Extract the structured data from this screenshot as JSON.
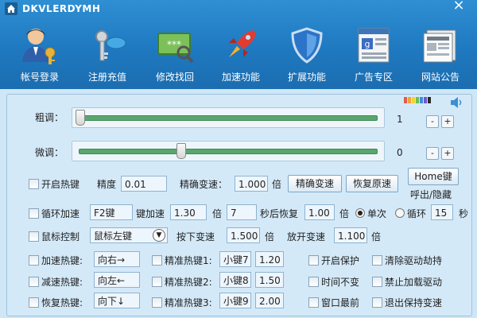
{
  "app": {
    "title": "DKVLERDYMH",
    "close_symbol": "×"
  },
  "nav": [
    {
      "label": "帐号登录",
      "icon": "user-key-icon"
    },
    {
      "label": "注册充值",
      "icon": "keys-icon"
    },
    {
      "label": "修改找回",
      "icon": "password-magnifier-icon"
    },
    {
      "label": "加速功能",
      "icon": "rocket-icon"
    },
    {
      "label": "扩展功能",
      "icon": "shield-icon"
    },
    {
      "label": "广告专区",
      "icon": "ad-page-icon"
    },
    {
      "label": "网站公告",
      "icon": "news-icon"
    }
  ],
  "coarse": {
    "label": "粗调：",
    "value": "1",
    "minus": "-",
    "plus": "+",
    "level": 0.0
  },
  "fine": {
    "label": "微调：",
    "value": "0",
    "minus": "-",
    "plus": "+",
    "level": 0.34
  },
  "row1": {
    "hotkey_label": "开启热键",
    "precision_label": "精度",
    "precision_value": "0.01",
    "exact_speed_label": "精确变速：",
    "exact_speed_value": "1.000",
    "times": "倍",
    "exact_speed_button": "精确变速",
    "restore_button": "恢复原速",
    "home_button": "Home键",
    "home_caption": "呼出/隐藏"
  },
  "row2": {
    "loop_label": "循环加速",
    "loop_key": "F2键",
    "key_speed_label": "键加速",
    "key_speed_value": "1.30",
    "times": "倍",
    "seconds_value": "7",
    "seconds_restore_label": "秒后恢复",
    "restore_value": "1.00",
    "times2": "倍",
    "single_label": "单次",
    "loop_radio_label": "循环",
    "loop_seconds": "15",
    "sec_unit": "秒"
  },
  "row3": {
    "mouse_label": "鼠标控制",
    "mouse_select": "鼠标左键",
    "press_speed_label": "按下变速",
    "press_value": "1.500",
    "times": "倍",
    "release_label": "放开变速",
    "release_value": "1.100",
    "times2": "倍"
  },
  "hotkeys": [
    {
      "label": "加速热键:",
      "key": "向右→",
      "precise_label": "精准热键1:",
      "precise_key": "小键7",
      "precise_value": "1.20",
      "opt1": "开启保护",
      "opt2": "清除驱动劫持"
    },
    {
      "label": "减速热键:",
      "key": "向左←",
      "precise_label": "精准热键2:",
      "precise_key": "小键8",
      "precise_value": "1.50",
      "opt1": "时间不变",
      "opt2": "禁止加载驱动"
    },
    {
      "label": "恢复热键:",
      "key": "向下↓",
      "precise_label": "精准热键3:",
      "precise_key": "小键9",
      "precise_value": "2.00",
      "opt1": "窗口最前",
      "opt2": "退出保持变速"
    }
  ],
  "colors": {
    "header_blue": "#2f8fd3",
    "panel": "#d4e9f8",
    "track_green": "#5aa66f"
  }
}
